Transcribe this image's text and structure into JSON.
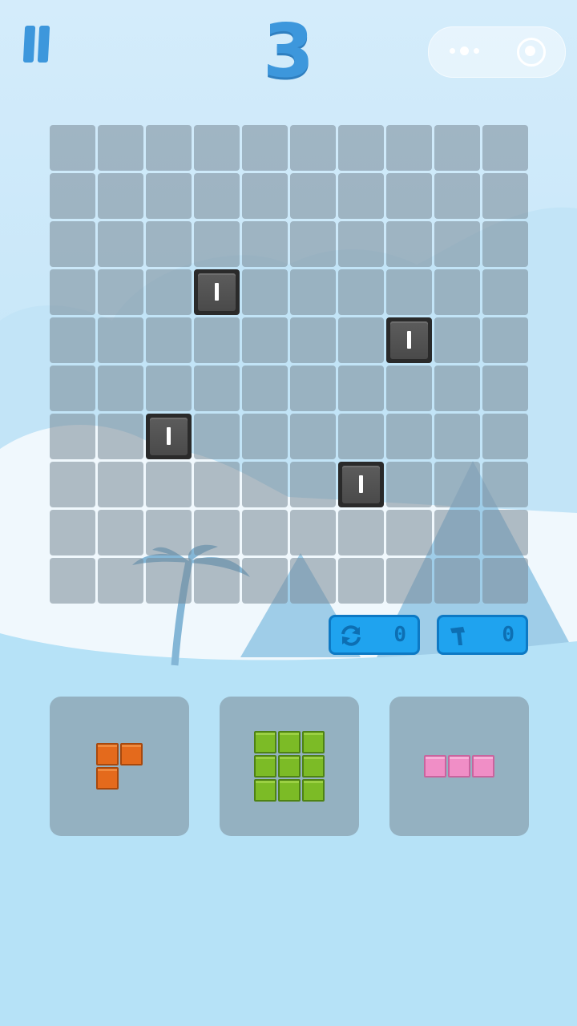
{
  "header": {
    "score": "3"
  },
  "colors": {
    "accent": "#3d97dc",
    "tool_button": "#1fa3ef",
    "obstacle": "#4a4a4a",
    "piece_orange": "#e46a1c",
    "piece_green": "#7cbb26",
    "piece_pink": "#f08ec6"
  },
  "board": {
    "rows": 10,
    "cols": 10,
    "obstacles": [
      {
        "row": 3,
        "col": 3,
        "label": "I"
      },
      {
        "row": 4,
        "col": 7,
        "label": "I"
      },
      {
        "row": 6,
        "col": 2,
        "label": "I"
      },
      {
        "row": 7,
        "col": 6,
        "label": "I"
      }
    ]
  },
  "tools": {
    "rotate": {
      "icon": "rotate-icon",
      "count": "0"
    },
    "hammer": {
      "icon": "hammer-icon",
      "count": "0"
    }
  },
  "pieces": [
    {
      "color": "orange",
      "shape": [
        [
          1,
          1
        ],
        [
          1,
          0
        ]
      ]
    },
    {
      "color": "green",
      "shape": [
        [
          1,
          1,
          1
        ],
        [
          1,
          1,
          1
        ],
        [
          1,
          1,
          1
        ]
      ]
    },
    {
      "color": "pink",
      "shape": [
        [
          1,
          1,
          1
        ]
      ]
    }
  ]
}
